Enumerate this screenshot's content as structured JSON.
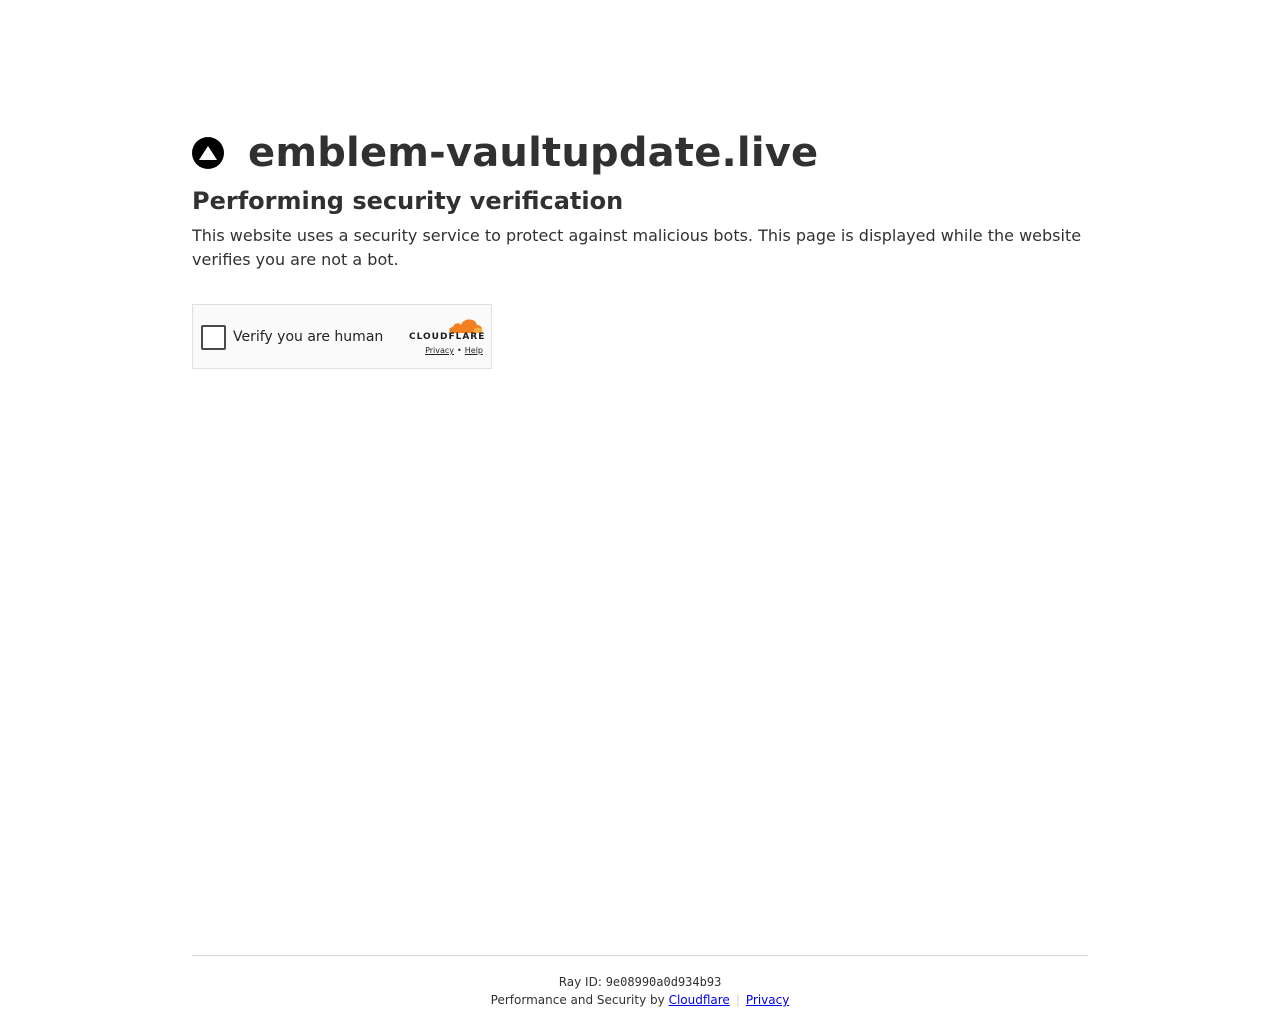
{
  "header": {
    "site_icon": "triangle-warning-icon",
    "site_name": "emblem-vaultupdate.live"
  },
  "main": {
    "heading": "Performing security verification",
    "description": "This website uses a security service to protect against malicious bots. This page is displayed while the website verifies you are not a bot."
  },
  "widget": {
    "checkbox_label": "Verify you are human",
    "checked": false,
    "brand": "CLOUDFLARE",
    "privacy_link": "Privacy",
    "separator": "•",
    "help_link": "Help"
  },
  "footer": {
    "ray_label": "Ray ID:",
    "ray_id": "9e08990a0d934b93",
    "perf_text": "Performance and Security by",
    "cloudflare_link": "Cloudflare",
    "separator": "|",
    "privacy_link": "Privacy"
  },
  "colors": {
    "text": "#313131",
    "link": "#0000ee",
    "cloudflare_orange": "#f38020",
    "cloudflare_light_orange": "#faad3f"
  }
}
